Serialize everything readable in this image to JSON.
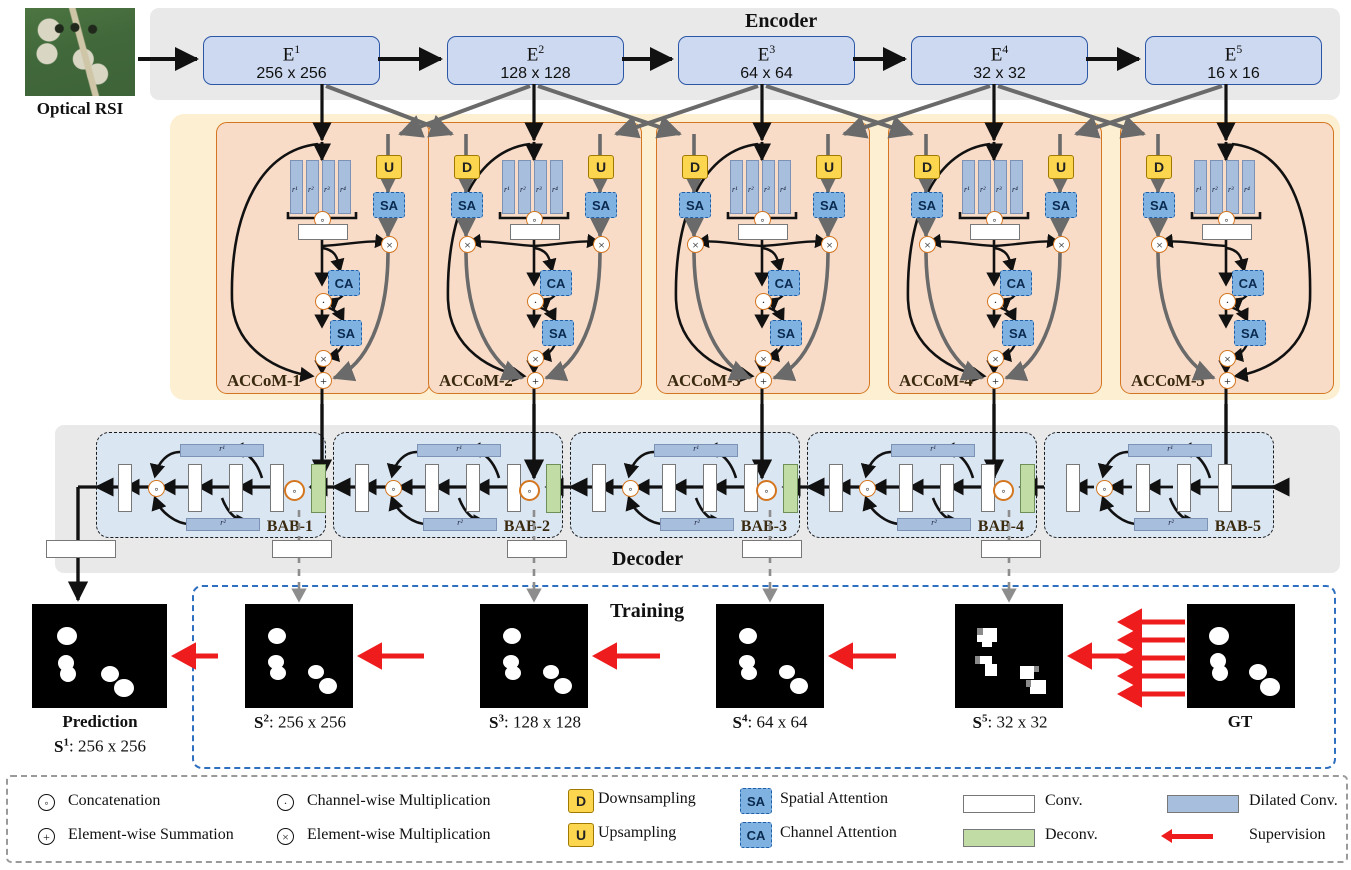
{
  "bands": {
    "encoder_title": "Encoder",
    "decoder_title": "Decoder",
    "training_title": "Training"
  },
  "input": {
    "label": "Optical RSI"
  },
  "encoder": {
    "blocks": [
      {
        "name": "E",
        "sup": "1",
        "size": "256 x 256"
      },
      {
        "name": "E",
        "sup": "2",
        "size": "128 x 128"
      },
      {
        "name": "E",
        "sup": "3",
        "size": "64 x 64"
      },
      {
        "name": "E",
        "sup": "4",
        "size": "32 x 32"
      },
      {
        "name": "E",
        "sup": "5",
        "size": "16 x 16"
      }
    ]
  },
  "accom": {
    "labels": [
      "ACCoM-1",
      "ACCoM-2",
      "ACCoM-3",
      "ACCoM-4",
      "ACCoM-5"
    ],
    "dilation_rates": [
      "r¹",
      "r²",
      "r³",
      "r⁴"
    ],
    "down_label": "D",
    "up_label": "U",
    "spatial_attention": "SA",
    "channel_attention": "CA",
    "branches": [
      {
        "down": false,
        "up": true
      },
      {
        "down": true,
        "up": true
      },
      {
        "down": true,
        "up": true
      },
      {
        "down": true,
        "up": true
      },
      {
        "down": true,
        "up": false
      }
    ]
  },
  "decoder": {
    "labels": [
      "BAB-1",
      "BAB-2",
      "BAB-3",
      "BAB-4",
      "BAB-5"
    ],
    "dilation_rates": [
      "r¹",
      "r²"
    ]
  },
  "outputs": {
    "prediction_title": "Prediction",
    "prediction_sub_name": "S",
    "prediction_sub_sup": "1",
    "prediction_sub_size": ": 256 x 256",
    "maps": [
      {
        "name": "S",
        "sup": "2",
        "size": ": 256 x 256"
      },
      {
        "name": "S",
        "sup": "3",
        "size": ": 128 x 128"
      },
      {
        "name": "S",
        "sup": "4",
        "size": ": 64 x 64"
      },
      {
        "name": "S",
        "sup": "5",
        "size": ": 32 x 32"
      }
    ],
    "gt_label": "GT"
  },
  "legend": {
    "items": [
      {
        "icon": "concat-circle-icon",
        "label": "Concatenation"
      },
      {
        "icon": "sum-circle-icon",
        "label": "Element-wise Summation"
      },
      {
        "icon": "dot-circle-icon",
        "label": "Channel-wise Multiplication"
      },
      {
        "icon": "cross-circle-icon",
        "label": "Element-wise Multiplication"
      },
      {
        "icon": "downsample-icon",
        "label": "Downsampling",
        "glyph": "D"
      },
      {
        "icon": "upsample-icon",
        "label": "Upsampling",
        "glyph": "U"
      },
      {
        "icon": "spatial-attention-icon",
        "label": "Spatial Attention",
        "glyph": "SA"
      },
      {
        "icon": "channel-attention-icon",
        "label": "Channel Attention",
        "glyph": "CA"
      },
      {
        "icon": "conv-bar-icon",
        "label": "Conv."
      },
      {
        "icon": "deconv-bar-icon",
        "label": "Deconv."
      },
      {
        "icon": "dilated-conv-bar-icon",
        "label": "Dilated Conv."
      },
      {
        "icon": "supervision-arrow-icon",
        "label": "Supervision"
      }
    ]
  },
  "colors": {
    "encoder_block": "#ccd9f0",
    "encoder_border": "#2b56a5",
    "accom_box": "#f8dcc8",
    "accom_border": "#d4761f",
    "accom_band": "#fdf0d2",
    "bab_box": "#dbe6f3",
    "band_gray": "#e9e9e9",
    "training_border": "#2f6fc0",
    "dilated_conv": "#a8bedd",
    "deconv": "#c2dca6",
    "attention": "#7fb2e0",
    "sampler": "#fcd64f",
    "supervision": "#ee1c1c"
  }
}
